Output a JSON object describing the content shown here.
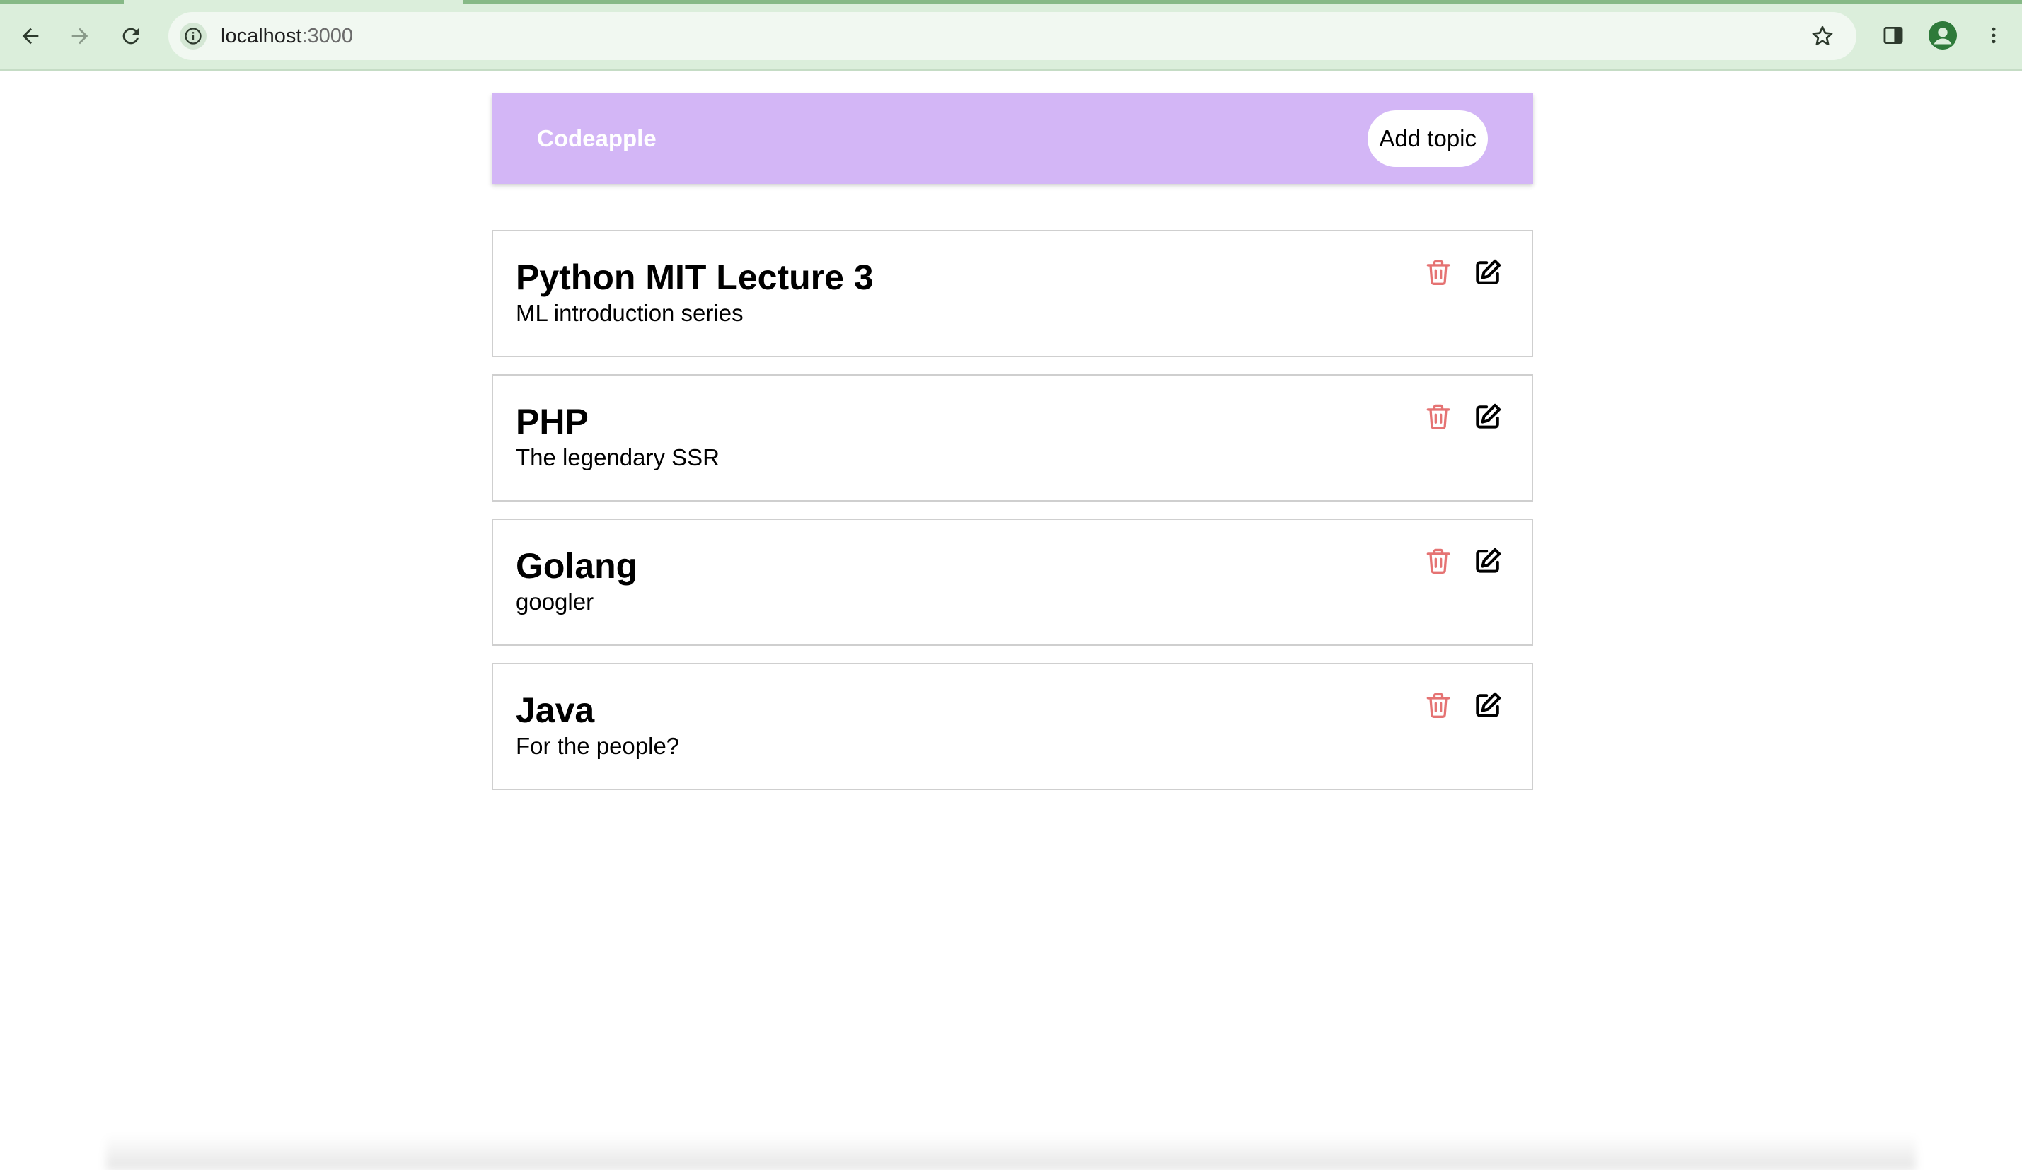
{
  "browser": {
    "url_host": "localhost",
    "url_port": ":3000",
    "icons": {
      "back": "arrow-left-icon",
      "forward": "arrow-right-icon",
      "reload": "reload-icon",
      "site_info": "info-icon",
      "bookmark": "star-icon",
      "side_panel": "side-panel-icon",
      "profile": "profile-icon",
      "menu": "kebab-menu-icon"
    }
  },
  "navbar": {
    "brand": "Codeapple",
    "add_button": "Add topic",
    "background": "#d3b6f6"
  },
  "topics": [
    {
      "title": "Python MIT Lecture 3",
      "description": "ML introduction series"
    },
    {
      "title": "PHP",
      "description": "The legendary SSR"
    },
    {
      "title": "Golang",
      "description": "googler"
    },
    {
      "title": "Java",
      "description": "For the people?"
    }
  ],
  "colors": {
    "delete_icon": "#e57373",
    "edit_icon": "#000000",
    "chrome_bg": "#dbeedb"
  }
}
